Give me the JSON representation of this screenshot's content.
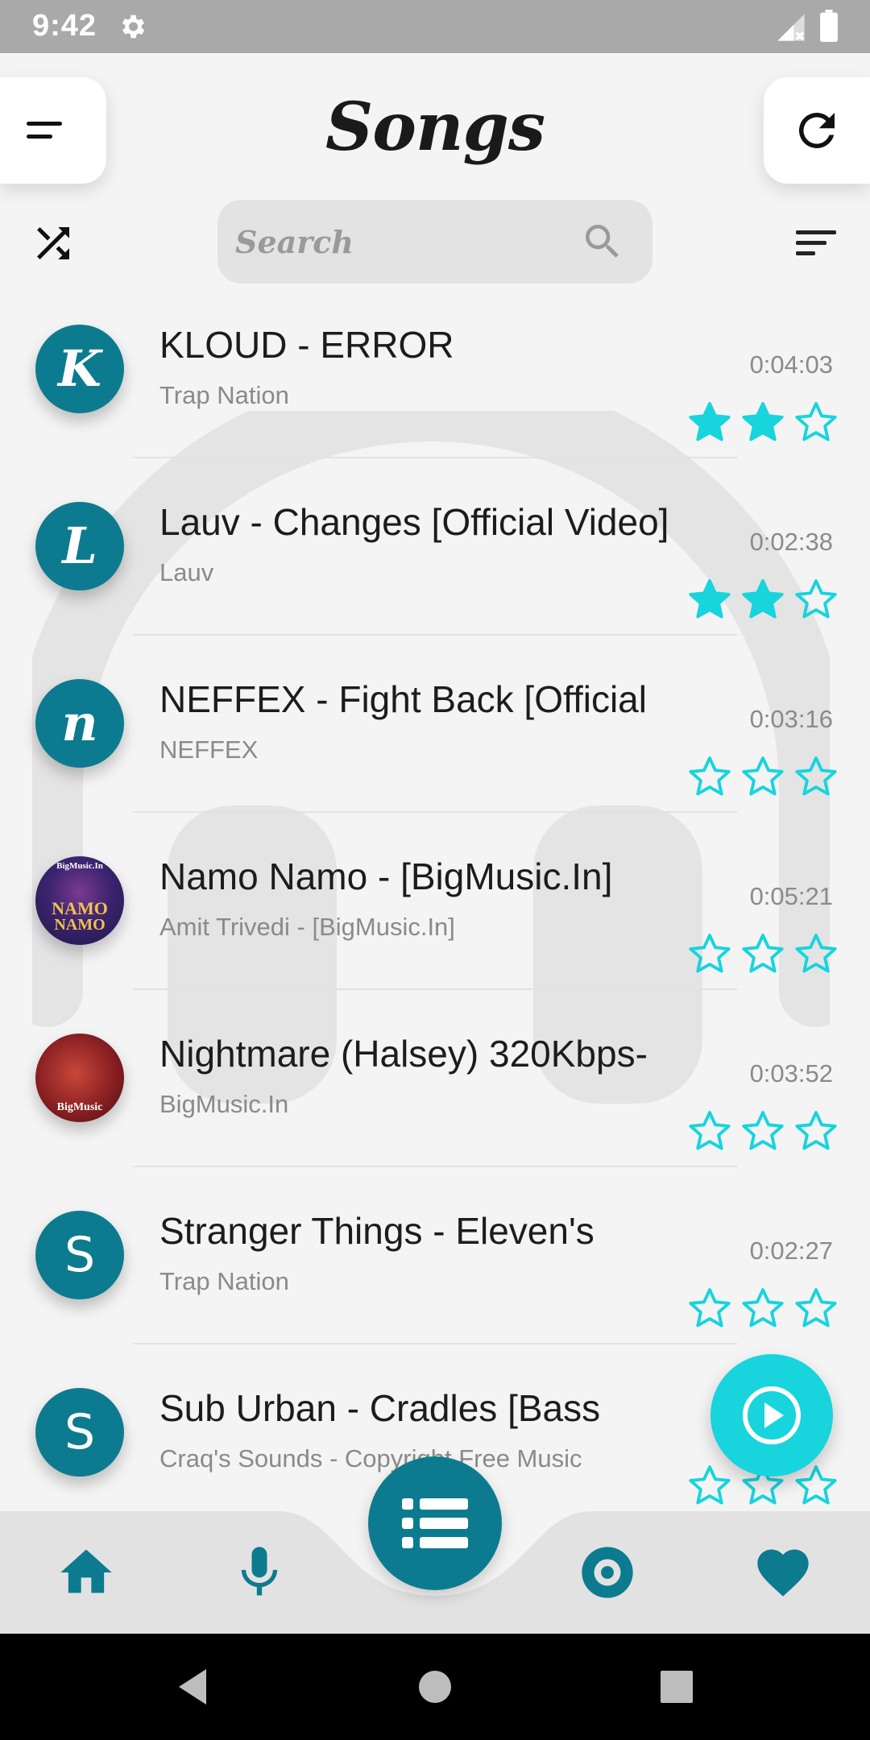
{
  "status_bar": {
    "time": "9:42"
  },
  "header": {
    "title": "Songs"
  },
  "search": {
    "placeholder": "Search"
  },
  "songs": [
    {
      "title": "KLOUD - ERROR",
      "artist": "Trap Nation",
      "duration": "0:04:03",
      "avatar_letter": "K",
      "rating": 2
    },
    {
      "title": "Lauv - Changes [Official Video]",
      "artist": "Lauv",
      "duration": "0:02:38",
      "avatar_letter": "L",
      "rating": 2
    },
    {
      "title": "NEFFEX - Fight Back [Official",
      "artist": "NEFFEX",
      "duration": "0:03:16",
      "avatar_letter": "n",
      "rating": 0
    },
    {
      "title": "Namo Namo - [BigMusic.In]",
      "artist": "Amit Trivedi - [BigMusic.In]",
      "duration": "0:05:21",
      "avatar_art_text": [
        "BigMusic.In",
        "NAMO",
        "NAMO"
      ],
      "rating": 0
    },
    {
      "title": "Nightmare (Halsey) 320Kbps-",
      "artist": "BigMusic.In",
      "duration": "0:03:52",
      "avatar_art_text": [
        "BigMusic"
      ],
      "rating": 0
    },
    {
      "title": "Stranger Things - Eleven's",
      "artist": "Trap Nation",
      "duration": "0:02:27",
      "avatar_letter": "S",
      "rating": 0
    },
    {
      "title": "Sub Urban - Cradles [Bass",
      "artist": "Craq's Sounds - Copyright Free Music",
      "duration": "",
      "avatar_letter": "S",
      "rating": 0
    }
  ],
  "rating_max": 3,
  "colors": {
    "accent": "#17d4dd",
    "primary": "#0d7b8f",
    "status_bar": "#a9a9a9",
    "star": "#17d4dd"
  },
  "icons": {
    "menu": "menu-icon",
    "refresh": "refresh-icon",
    "shuffle": "shuffle-icon",
    "search": "search-icon",
    "sort": "sort-icon",
    "play": "play-icon",
    "nav": [
      "home-icon",
      "microphone-icon",
      "list-icon",
      "album-icon",
      "heart-icon"
    ]
  }
}
